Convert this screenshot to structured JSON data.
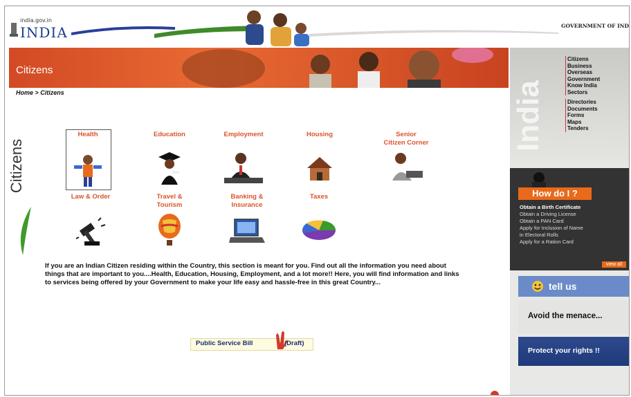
{
  "header": {
    "site_small": "india.gov.in",
    "site_big": "INDIA",
    "gov_text": "GOVERNMENT OF IND"
  },
  "banner": {
    "title": "Citizens"
  },
  "breadcrumb": "Home > Citizens",
  "side_label": "Citizens",
  "categories": [
    {
      "label": "Health",
      "icon": "health-icon"
    },
    {
      "label": "Education",
      "icon": "graduate-icon"
    },
    {
      "label": "Employment",
      "icon": "businessman-icon"
    },
    {
      "label": "Housing",
      "icon": "house-icon"
    },
    {
      "label": "Senior\nCitizen Corner",
      "icon": "senior-icon"
    },
    {
      "label": "Law & Order",
      "icon": "gavel-icon"
    },
    {
      "label": "Travel &\nTourism",
      "icon": "balloon-icon"
    },
    {
      "label": "Banking &\nInsurance",
      "icon": "laptop-icon"
    },
    {
      "label": "Taxes",
      "icon": "pie-icon"
    }
  ],
  "intro": "If you are an Indian Citizen residing within the Country, this section is meant for you. Find out all the information you need about things that are important to you....Health, Education, Housing, Employment, and a lot more!! Here, you will find information and links to services being offered by your Government to make your life easy and hassle-free in this great Country...",
  "public_service_bill": {
    "label": "Public Service Bill",
    "suffix": "(Draft)"
  },
  "right_panel": {
    "india_word": "India",
    "nav_group1": [
      "Citizens",
      "Business",
      "Overseas",
      "Government",
      "Know India",
      "Sectors"
    ],
    "nav_group2": [
      "Directories",
      "Documents",
      "Forms",
      "Maps",
      "Tenders"
    ],
    "howdo_title": "How do I ?",
    "howdo_items": [
      "Obtain a Birth Certificate",
      "Obtain a Driving License",
      "Obtain a PAN Card",
      "Apply for Inclusion of Name",
      "in Electoral Rolls",
      "Apply for a Ration Card"
    ],
    "view_all": "view all",
    "tell_us": "tell us",
    "avoid": "Avoid the menace...",
    "protect": "Protect your rights !!"
  },
  "colors": {
    "banner": "#d24a24",
    "category_text": "#d9542b",
    "howdo_bg": "#333333",
    "accent_orange": "#e86a1a",
    "protect_bg": "#2e4a8e"
  }
}
